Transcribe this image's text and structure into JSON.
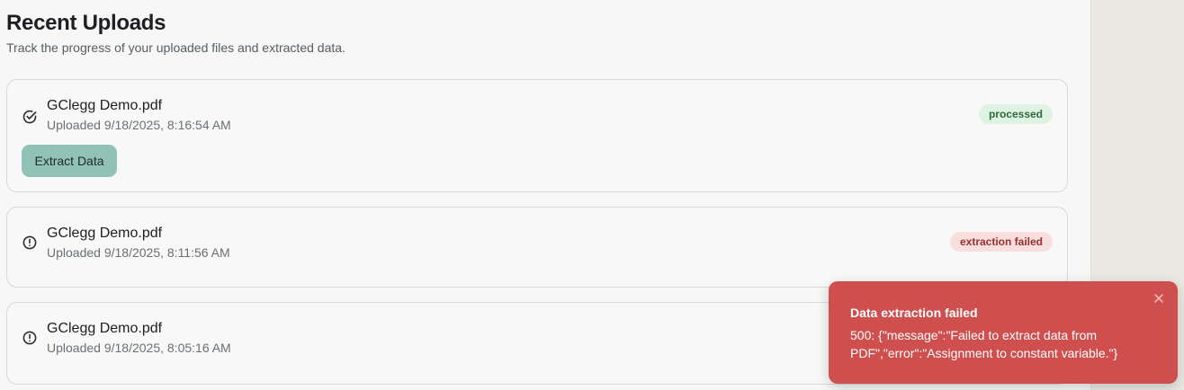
{
  "header": {
    "title": "Recent Uploads",
    "subtitle": "Track the progress of your uploaded files and extracted data."
  },
  "uploads": [
    {
      "file_name": "GClegg Demo.pdf",
      "uploaded": "Uploaded 9/18/2025, 8:16:54 AM",
      "status": "processed",
      "status_icon": "check-circle-icon",
      "action_label": "Extract Data"
    },
    {
      "file_name": "GClegg Demo.pdf",
      "uploaded": "Uploaded 9/18/2025, 8:11:56 AM",
      "status": "extraction failed",
      "status_icon": "alert-circle-icon"
    },
    {
      "file_name": "GClegg Demo.pdf",
      "uploaded": "Uploaded 9/18/2025, 8:05:16 AM",
      "status_icon": "alert-circle-icon"
    }
  ],
  "toast": {
    "title": "Data extraction failed",
    "message": "500: {\"message\":\"Failed to extract data from PDF\",\"error\":\"Assignment to constant variable.\"}",
    "close_icon": "close-icon"
  },
  "colors": {
    "processed_badge_bg": "#dff3e2",
    "failed_badge_bg": "#f9dede",
    "button_bg": "#91c2b5",
    "toast_bg": "#cf4f4f"
  }
}
